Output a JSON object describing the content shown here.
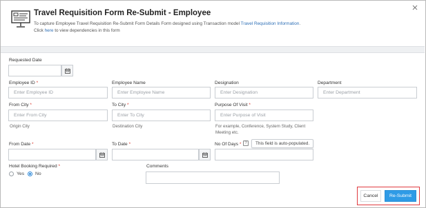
{
  "header": {
    "title": "Travel Requisition Form Re-Submit - Employee",
    "desc_prefix": "To capture Employee Travel Requisition Re-Submit Form Details Form designed using Transaction model ",
    "desc_link": "Travel Requisition Information",
    "desc_suffix": ".",
    "click_prefix": "Click ",
    "click_link": "here",
    "click_suffix": " to view dependencies in this form"
  },
  "fields": {
    "requested_date": {
      "label": "Requested Date",
      "value": ""
    },
    "employee_id": {
      "label": "Employee ID",
      "req": "*",
      "placeholder": "Enter Employee ID"
    },
    "employee_name": {
      "label": "Employee Name",
      "placeholder": "Enter Employee Name"
    },
    "designation": {
      "label": "Designation",
      "placeholder": "Enter Designation"
    },
    "department": {
      "label": "Department",
      "placeholder": "Enter Department"
    },
    "from_city": {
      "label": "From City",
      "req": "*",
      "placeholder": "Enter From City",
      "helper": "Origin City"
    },
    "to_city": {
      "label": "To City",
      "req": "*",
      "placeholder": "Enter To City",
      "helper": "Destination City"
    },
    "purpose": {
      "label": "Purpose Of Visit",
      "req": "*",
      "placeholder": "Enter Purpose of Visit",
      "helper_line1": "For example, Conference, System Study, Client",
      "helper_line2": "Meeting etc."
    },
    "from_date": {
      "label": "From Date",
      "req": "*"
    },
    "to_date": {
      "label": "To Date",
      "req": "*"
    },
    "no_of_days": {
      "label": "No Of Days",
      "req": "*",
      "tooltip": "This field is auto-populated."
    },
    "hotel": {
      "label": "Hotel Booking Required",
      "req": "*",
      "options": [
        "Yes",
        "No"
      ],
      "selected": "No"
    },
    "comments": {
      "label": "Comments"
    }
  },
  "actions": {
    "cancel": "Cancel",
    "resubmit": "Re-Submit"
  },
  "colors": {
    "primary": "#2f9be6",
    "required": "#d9362b",
    "link": "#2e6fb6",
    "highlight_border": "#e0393e"
  }
}
